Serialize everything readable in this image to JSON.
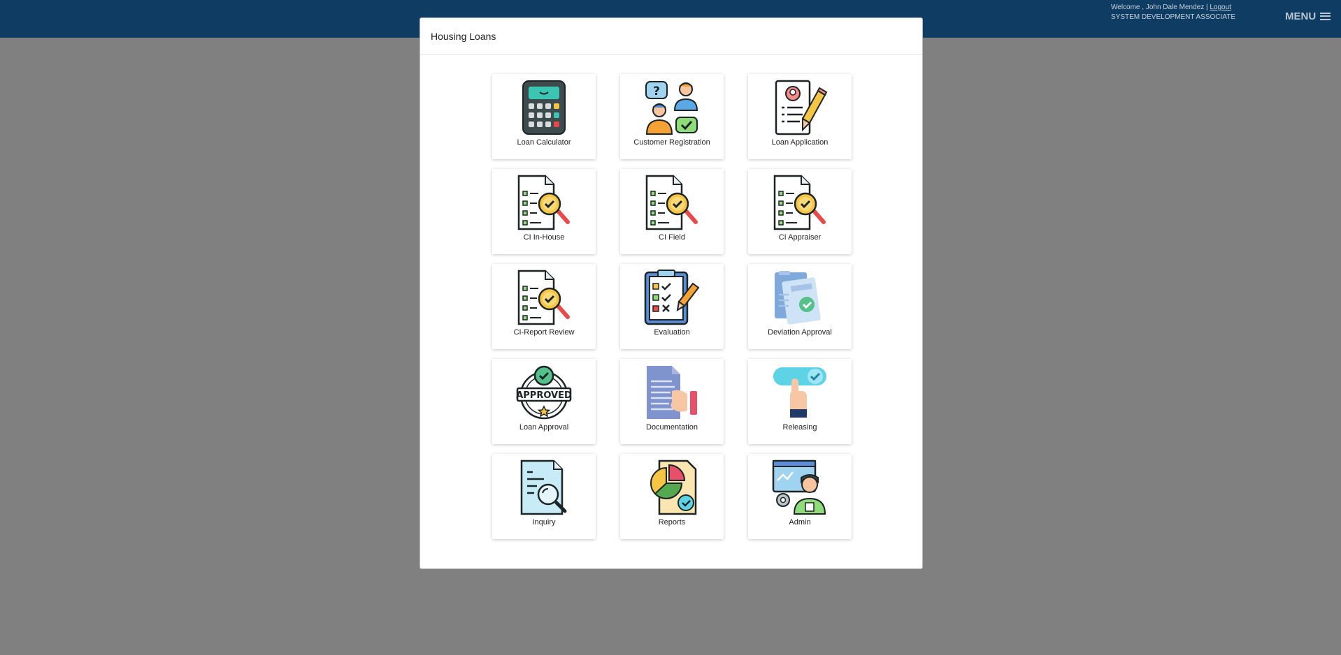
{
  "header": {
    "welcome_text": "Welcome , John Dale Mendez |",
    "logout_label": "Logout",
    "role": "SYSTEM DEVELOPMENT ASSOCIATE",
    "menu_label": "MENU"
  },
  "modal": {
    "title": "Housing Loans",
    "tiles": [
      {
        "label": "Loan Calculator",
        "icon": "calculator-icon"
      },
      {
        "label": "Customer Registration",
        "icon": "customer-registration-icon"
      },
      {
        "label": "Loan Application",
        "icon": "loan-application-icon"
      },
      {
        "label": "CI In-House",
        "icon": "document-check-magnifier-icon"
      },
      {
        "label": "CI Field",
        "icon": "document-check-magnifier-icon"
      },
      {
        "label": "CI Appraiser",
        "icon": "document-check-magnifier-icon"
      },
      {
        "label": "CI-Report Review",
        "icon": "document-check-magnifier-icon"
      },
      {
        "label": "Evaluation",
        "icon": "clipboard-checklist-icon"
      },
      {
        "label": "Deviation Approval",
        "icon": "document-approval-icon"
      },
      {
        "label": "Loan Approval",
        "icon": "approved-badge-icon"
      },
      {
        "label": "Documentation",
        "icon": "document-hand-icon"
      },
      {
        "label": "Releasing",
        "icon": "toggle-hand-icon"
      },
      {
        "label": "Inquiry",
        "icon": "document-search-icon"
      },
      {
        "label": "Reports",
        "icon": "report-chart-icon"
      },
      {
        "label": "Admin",
        "icon": "admin-user-icon"
      }
    ]
  },
  "colors": {
    "topbar": "#0f3c62",
    "overlay": "#808080",
    "modal_bg": "#ffffff"
  }
}
